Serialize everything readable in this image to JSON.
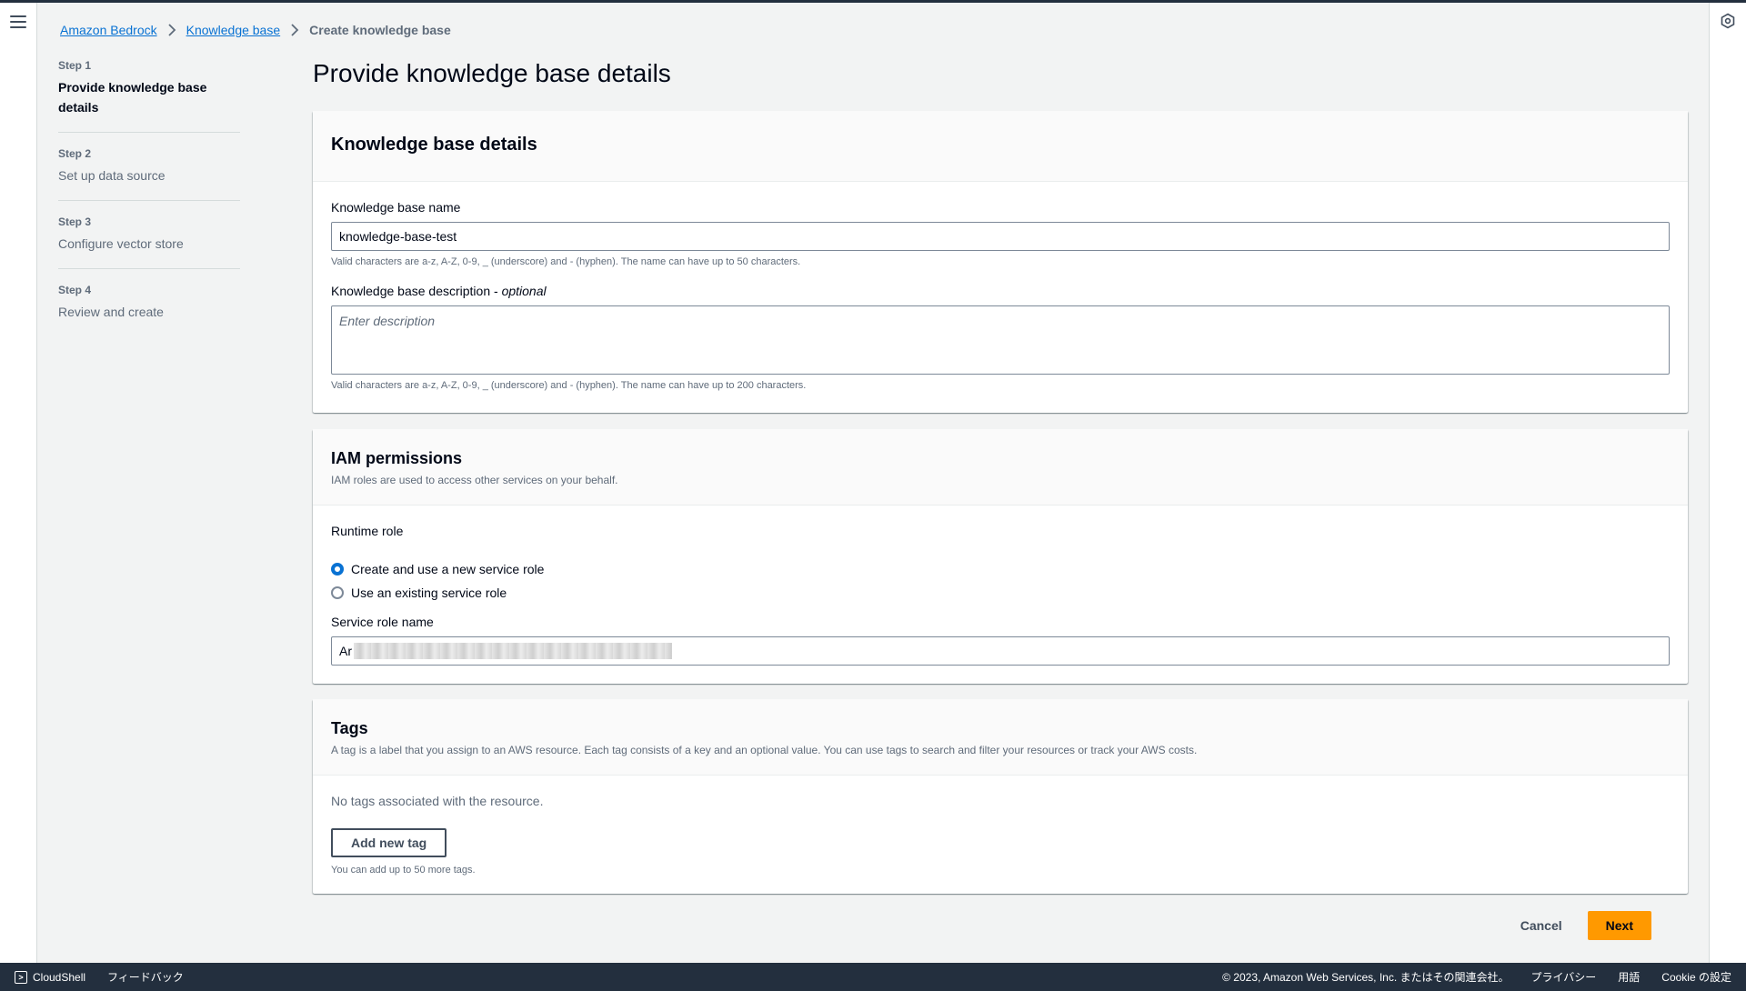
{
  "breadcrumb": {
    "items": [
      "Amazon Bedrock",
      "Knowledge base"
    ],
    "current": "Create knowledge base"
  },
  "wizard": {
    "steps": [
      {
        "number": "Step 1",
        "label": "Provide knowledge base details"
      },
      {
        "number": "Step 2",
        "label": "Set up data source"
      },
      {
        "number": "Step 3",
        "label": "Configure vector store"
      },
      {
        "number": "Step 4",
        "label": "Review and create"
      }
    ]
  },
  "page": {
    "title": "Provide knowledge base details"
  },
  "kb_details": {
    "title": "Knowledge base details",
    "name_label": "Knowledge base name",
    "name_value": "knowledge-base-test",
    "name_hint": "Valid characters are a-z, A-Z, 0-9, _ (underscore) and - (hyphen). The name can have up to 50 characters.",
    "desc_label": "Knowledge base description",
    "desc_optional": "optional",
    "desc_placeholder": "Enter description",
    "desc_hint": "Valid characters are a-z, A-Z, 0-9, _ (underscore) and - (hyphen). The name can have up to 200 characters."
  },
  "iam": {
    "title": "IAM permissions",
    "description": "IAM roles are used to access other services on your behalf.",
    "runtime_role_label": "Runtime role",
    "option_new": "Create and use a new service role",
    "option_existing": "Use an existing service role",
    "service_role_label": "Service role name",
    "service_role_value": "Ar"
  },
  "tags": {
    "title": "Tags",
    "description": "A tag is a label that you assign to an AWS resource. Each tag consists of a key and an optional value. You can use tags to search and filter your resources or track your AWS costs.",
    "empty_text": "No tags associated with the resource.",
    "add_button": "Add new tag",
    "hint": "You can add up to 50 more tags."
  },
  "actions": {
    "cancel": "Cancel",
    "next": "Next"
  },
  "footer": {
    "cloudshell": "CloudShell",
    "feedback": "フィードバック",
    "copyright": "© 2023, Amazon Web Services, Inc. またはその関連会社。",
    "privacy": "プライバシー",
    "terms": "用語",
    "cookie": "Cookie の設定"
  },
  "colors": {
    "accent": "#0972d3",
    "primary_button": "#ff9900",
    "footer_bg": "#232f3e"
  }
}
